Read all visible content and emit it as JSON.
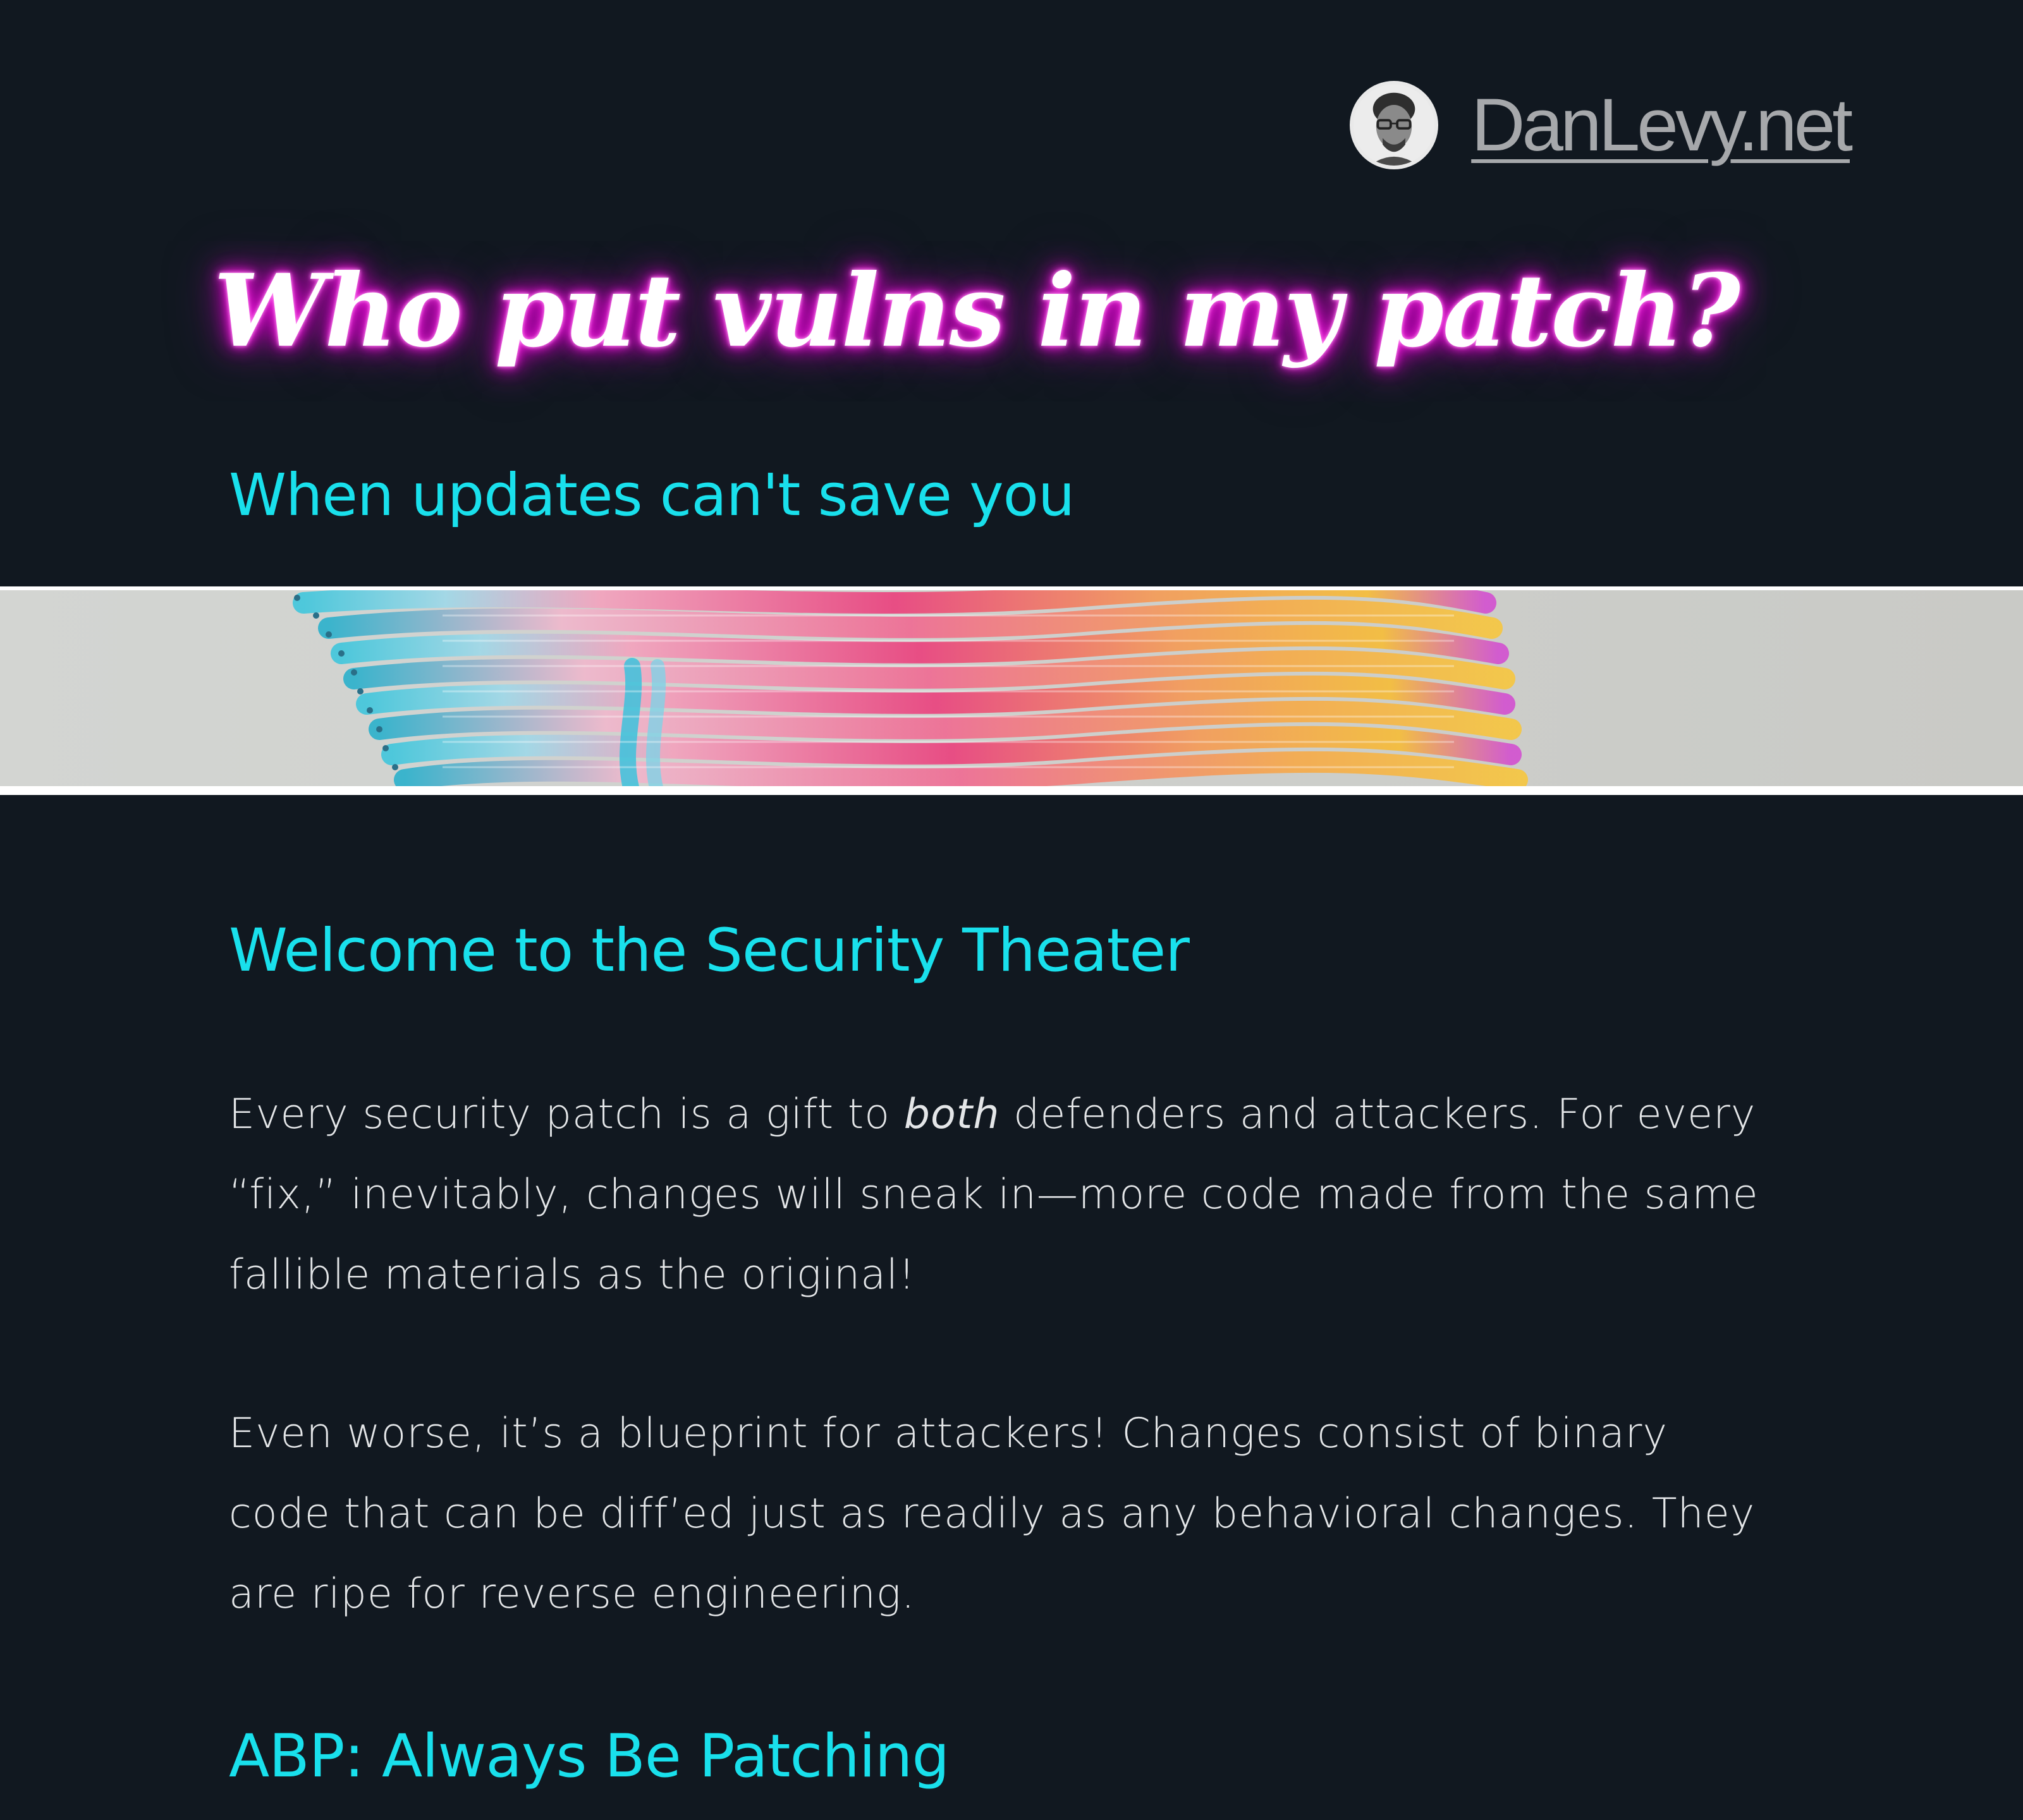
{
  "header": {
    "site_name": "DanLevy.net",
    "avatar_alt": "Dan Levy avatar"
  },
  "hero": {
    "title": "Who put vulns in my patch?",
    "subtitle": "When updates can't save you"
  },
  "banner": {
    "icon": "abstract-colorful-strands-image"
  },
  "article": {
    "section1": {
      "heading": "Welcome to the Security Theater",
      "p1_before": "Every security patch is a gift to ",
      "p1_em": "both",
      "p1_after": " defenders and attackers. For every “fix,” inevitably, changes will sneak in—more code made from the same fallible materials as the original!",
      "p2": "Even worse, it’s a blueprint for attackers! Changes consist of binary code that can be diff’ed just as readily as any behavioral changes. They are ripe for reverse engineering."
    },
    "section2": {
      "heading": "ABP: Always Be Patching"
    }
  },
  "colors": {
    "background": "#111820",
    "accent_cyan": "#19e0ec",
    "neon_magenta": "#ee00dc",
    "link_gray": "#a6a8ab"
  }
}
